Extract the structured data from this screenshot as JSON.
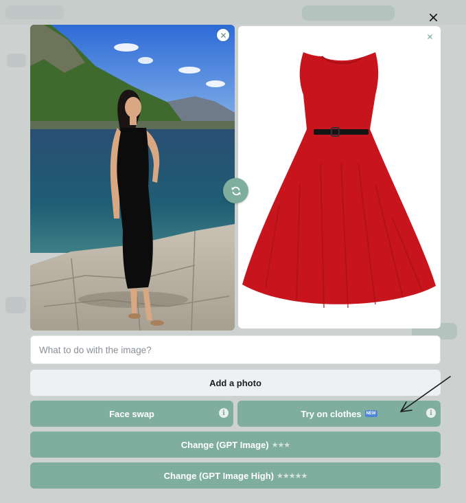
{
  "modal": {
    "close_label": "×",
    "prompt_placeholder": "What to do with the image?",
    "add_photo_label": "Add a photo",
    "buttons": {
      "face_swap": "Face swap",
      "try_on": "Try on clothes",
      "try_on_badge": "NEW",
      "change_gpt": "Change (GPT Image)",
      "change_gpt_stars": "★★★",
      "change_gpt_high": "Change (GPT Image High)",
      "change_gpt_high_stars": "★★★★★"
    },
    "info_glyph": "i"
  },
  "images": {
    "left": {
      "description": "woman in black dress by the sea",
      "icon": "photo"
    },
    "right": {
      "description": "red sleeveless dress with black belt",
      "icon": "photo"
    }
  },
  "colors": {
    "accent": "#7fae9e",
    "dress_red": "#c8141c",
    "secondary_button": "#eef1f3"
  }
}
